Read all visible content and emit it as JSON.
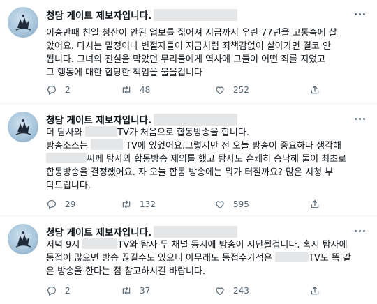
{
  "tweets": [
    {
      "author": "청담 게이트 제보자입니다.",
      "lines": [
        "이승만때 친일 청산이 안된 업보를 짊어져 지금까지 우린 77년을 고통속에 살",
        "았어요. 다시는 밀정이나 변절자들이 지금처럼 죄책감없이 살아가면 결코 안",
        "됩니다. 그녀의 진실을 막았던 무리들에게  역사에 그들이 어떤 죄를 지었고",
        "그 행동에 대한 합당한 책임을 물을겁니다"
      ],
      "replies": "2",
      "retweets": "48",
      "likes": "252"
    },
    {
      "author": "청담 게이트 제보자입니다.",
      "l1a": "더 탐사와",
      "l1b": "TV가 처음으로 합동방송을 합니다.",
      "l2a": "방송소스는",
      "l2b": "TV에 있었어요.그렇지만 전 오늘 방송이 중요하다 생각해",
      "l3b": "씨께 탐사와 합동방송 제의를 했고 탐사도 흔쾌히 승낙해 둘이 최초로",
      "l4": "합동방송을 결정했어요. 자 오늘 합동 방송에는 뭐가 터질까요? 많은 시청 부",
      "l5": "탁드립니다.",
      "replies": "29",
      "retweets": "132",
      "likes": "595"
    },
    {
      "author": "청담 게이트 제보자입니다.",
      "l1a": "저녁 9시",
      "l1b": "TV와 탐사 두 채널 동시에 방송이 시단될겁니다. 혹시 탐사에",
      "l2a": "동접이 많으면 방송 끊길수도 있으니 아무래도 동접수가적은",
      "l2b": "TV도 똑 같",
      "l3": "은 방송을 한다는 점 참고하시길 바랍니다.",
      "replies": "2",
      "retweets": "37",
      "likes": "243"
    }
  ],
  "icons": {
    "reply": "reply-icon",
    "retweet": "retweet-icon",
    "like": "heart-icon",
    "share": "share-icon",
    "more": "more-dots-icon"
  },
  "colors": {
    "muted": "#536471",
    "text": "#0f1419",
    "divider": "#eff3f4",
    "redaction": "#e4e6e8"
  }
}
